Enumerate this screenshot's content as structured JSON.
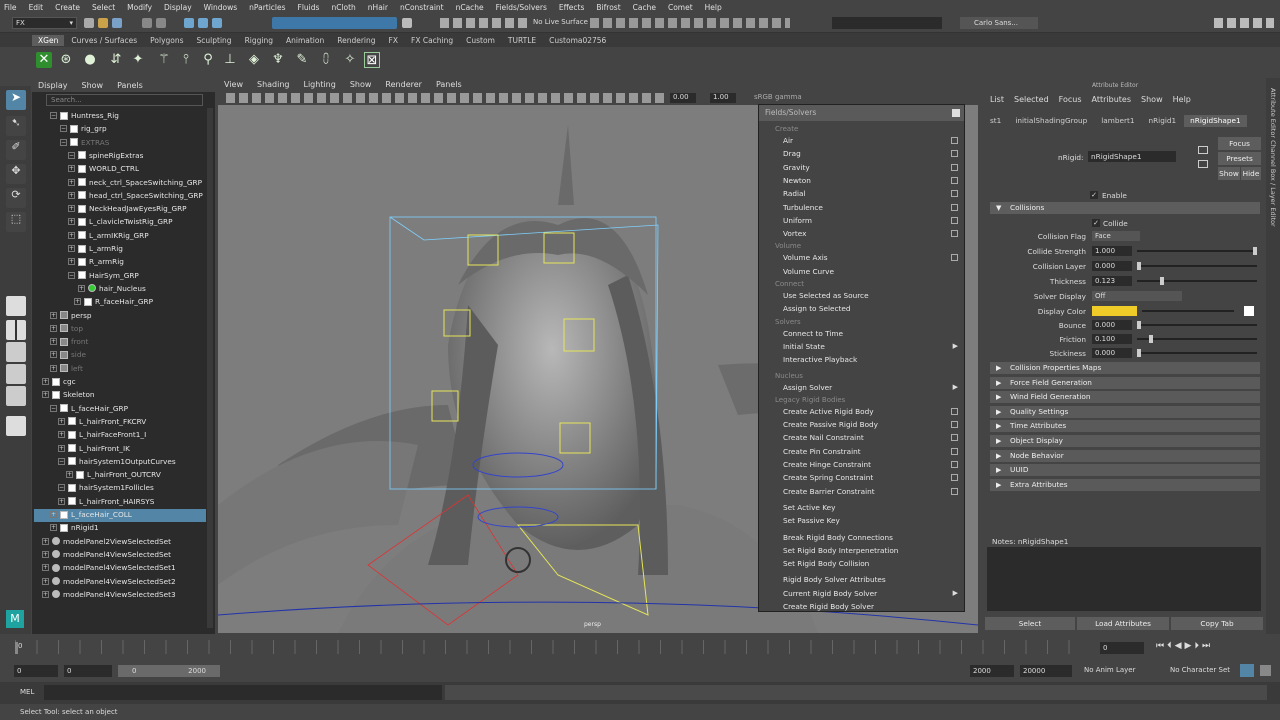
{
  "menubar": [
    "File",
    "Edit",
    "Create",
    "Select",
    "Modify",
    "Display",
    "Windows",
    "nParticles",
    "Fluids",
    "nCloth",
    "nHair",
    "nConstraint",
    "nCache",
    "Fields/Solvers",
    "Effects",
    "Bifrost",
    "Cache",
    "Comet",
    "Help"
  ],
  "toolbar": {
    "mode": "FX",
    "live_surface": "No Live Surface",
    "user": "Carlo Sans..."
  },
  "shelf_tabs": [
    "XGen",
    "Curves / Surfaces",
    "Polygons",
    "Sculpting",
    "Rigging",
    "Animation",
    "Rendering",
    "FX",
    "FX Caching",
    "Custom",
    "TURTLE",
    "Customa02756"
  ],
  "outliner": {
    "menu": [
      "Display",
      "Show",
      "Panels"
    ],
    "search_placeholder": "Search...",
    "rows": [
      {
        "label": "Huntress_Rig",
        "dim": false
      },
      {
        "label": "rig_grp",
        "dim": false
      },
      {
        "label": "EXTRAS",
        "dim": true
      },
      {
        "label": "spineRigExtras",
        "dim": false
      },
      {
        "label": "WORLD_CTRL",
        "dim": false
      },
      {
        "label": "neck_ctrl_SpaceSwitching_GRP",
        "dim": false
      },
      {
        "label": "head_ctrl_SpaceSwitching_GRP",
        "dim": false
      },
      {
        "label": "NeckHeadJawEyesRig_GRP",
        "dim": false
      },
      {
        "label": "L_clavicleTwistRig_GRP",
        "dim": false
      },
      {
        "label": "L_armIKRig_GRP",
        "dim": false
      },
      {
        "label": "L_armRig",
        "dim": false
      },
      {
        "label": "R_armRig",
        "dim": false
      },
      {
        "label": "HairSym_GRP",
        "dim": false
      },
      {
        "label": "hair_Nucleus",
        "dim": false
      },
      {
        "label": "R_faceHair_GRP",
        "dim": false
      },
      {
        "label": "persp",
        "dim": false
      },
      {
        "label": "top",
        "dim": true
      },
      {
        "label": "front",
        "dim": true
      },
      {
        "label": "side",
        "dim": true
      },
      {
        "label": "left",
        "dim": true
      },
      {
        "label": "cgc",
        "dim": false
      },
      {
        "label": "Skeleton",
        "dim": false
      },
      {
        "label": "L_faceHair_GRP",
        "dim": false
      },
      {
        "label": "L_hairFront_FKCRV",
        "dim": false
      },
      {
        "label": "L_hairFaceFront1_I",
        "dim": false
      },
      {
        "label": "L_hairFront_IK",
        "dim": false
      },
      {
        "label": "hairSystem1OutputCurves",
        "dim": false
      },
      {
        "label": "L_hairFront_OUTCRV",
        "dim": false
      },
      {
        "label": "hairSystem1Follicles",
        "dim": false
      },
      {
        "label": "L_hairFront_HAIRSYS",
        "dim": false
      },
      {
        "label": "L_faceHair_COLL",
        "dim": false
      },
      {
        "label": "nRigid1",
        "dim": false
      },
      {
        "label": "modelPanel2ViewSelectedSet",
        "dim": false
      },
      {
        "label": "modelPanel4ViewSelectedSet",
        "dim": false
      },
      {
        "label": "modelPanel4ViewSelectedSet1",
        "dim": false
      },
      {
        "label": "modelPanel4ViewSelectedSet2",
        "dim": false
      },
      {
        "label": "modelPanel4ViewSelectedSet3",
        "dim": false
      }
    ]
  },
  "viewport": {
    "menu": [
      "View",
      "Shading",
      "Lighting",
      "Show",
      "Renderer",
      "Panels"
    ],
    "values": [
      "0.00",
      "1.00"
    ],
    "gamma": "sRGB gamma",
    "camera": "persp"
  },
  "popup": {
    "title": "Fields/Solvers",
    "items": [
      {
        "t": "h",
        "label": "Create"
      },
      {
        "t": "i",
        "label": "Air",
        "box": true
      },
      {
        "t": "i",
        "label": "Drag",
        "box": true
      },
      {
        "t": "i",
        "label": "Gravity",
        "box": true
      },
      {
        "t": "i",
        "label": "Newton",
        "box": true
      },
      {
        "t": "i",
        "label": "Radial",
        "box": true
      },
      {
        "t": "i",
        "label": "Turbulence",
        "box": true
      },
      {
        "t": "i",
        "label": "Uniform",
        "box": true
      },
      {
        "t": "i",
        "label": "Vortex",
        "box": true
      },
      {
        "t": "h",
        "label": "Volume"
      },
      {
        "t": "i",
        "label": "Volume Axis",
        "box": true
      },
      {
        "t": "i",
        "label": "Volume Curve",
        "box": false
      },
      {
        "t": "h",
        "label": "Connect"
      },
      {
        "t": "i",
        "label": "Use Selected as Source",
        "box": false
      },
      {
        "t": "i",
        "label": "Assign to Selected",
        "box": false
      },
      {
        "t": "h",
        "label": "Solvers"
      },
      {
        "t": "i",
        "label": "Connect to Time",
        "box": false
      },
      {
        "t": "i",
        "label": "Initial State",
        "arrow": true
      },
      {
        "t": "i",
        "label": "Interactive Playback",
        "box": false
      },
      {
        "t": "h",
        "label": "Nucleus"
      },
      {
        "t": "i",
        "label": "Assign Solver",
        "arrow": true
      },
      {
        "t": "h",
        "label": "Legacy Rigid Bodies"
      },
      {
        "t": "i",
        "label": "Create Active Rigid Body",
        "box": true
      },
      {
        "t": "i",
        "label": "Create Passive Rigid Body",
        "box": true
      },
      {
        "t": "i",
        "label": "Create Nail Constraint",
        "box": true
      },
      {
        "t": "i",
        "label": "Create Pin Constraint",
        "box": true
      },
      {
        "t": "i",
        "label": "Create Hinge Constraint",
        "box": true
      },
      {
        "t": "i",
        "label": "Create Spring Constraint",
        "box": true
      },
      {
        "t": "i",
        "label": "Create Barrier Constraint",
        "box": true
      },
      {
        "t": "i",
        "label": "Set Active Key",
        "box": false
      },
      {
        "t": "i",
        "label": "Set Passive Key",
        "box": false
      },
      {
        "t": "i",
        "label": "Break Rigid Body Connections",
        "box": false
      },
      {
        "t": "i",
        "label": "Set Rigid Body Interpenetration",
        "box": false
      },
      {
        "t": "i",
        "label": "Set Rigid Body Collision",
        "box": false
      },
      {
        "t": "i",
        "label": "Rigid Body Solver Attributes",
        "box": false
      },
      {
        "t": "i",
        "label": "Current Rigid Body Solver",
        "arrow": true
      },
      {
        "t": "i",
        "label": "Create Rigid Body Solver",
        "box": false
      }
    ]
  },
  "attr": {
    "title": "Attribute Editor",
    "menu": [
      "List",
      "Selected",
      "Focus",
      "Attributes",
      "Show",
      "Help"
    ],
    "tabs": [
      "st1",
      "initialShadingGroup",
      "lambert1",
      "nRigid1",
      "nRigidShape1"
    ],
    "node_label": "nRigid:",
    "node_value": "nRigidShape1",
    "buttons": [
      "Focus",
      "Presets",
      "Show",
      "Hide"
    ],
    "enable": "Enable",
    "collisions": "Collisions",
    "collide": "Collide",
    "fields": [
      {
        "label": "Collision Flag",
        "value": "Face"
      },
      {
        "label": "Collide Strength",
        "value": "1.000"
      },
      {
        "label": "Collision Layer",
        "value": "0.000"
      },
      {
        "label": "Thickness",
        "value": "0.123"
      },
      {
        "label": "Solver Display",
        "value": "Off"
      },
      {
        "label": "Display Color",
        "value": ""
      },
      {
        "label": "Bounce",
        "value": "0.000"
      },
      {
        "label": "Friction",
        "value": "0.100"
      },
      {
        "label": "Stickiness",
        "value": "0.000"
      }
    ],
    "display_color": "#f0cc28",
    "sections": [
      "Collision Properties Maps",
      "Force Field Generation",
      "Wind Field Generation",
      "Quality Settings",
      "Time Attributes",
      "Object Display",
      "Node Behavior",
      "UUID",
      "Extra Attributes"
    ],
    "notes": "Notes:  nRigidShape1",
    "bottom_buttons": [
      "Select",
      "Load Attributes",
      "Copy Tab"
    ],
    "side_tabs": "Attribute Editor  Channel Box / Layer Editor"
  },
  "timeline": {
    "start": "0",
    "end": "0",
    "range_start": "0",
    "range_mid": "0",
    "range_end": "2000",
    "total_a": "2000",
    "total_b": "20000",
    "anim_layer": "No Anim Layer",
    "char_set": "No Character Set",
    "frame": "0"
  },
  "cmd": {
    "label": "MEL"
  },
  "help": "Select Tool: select an object"
}
